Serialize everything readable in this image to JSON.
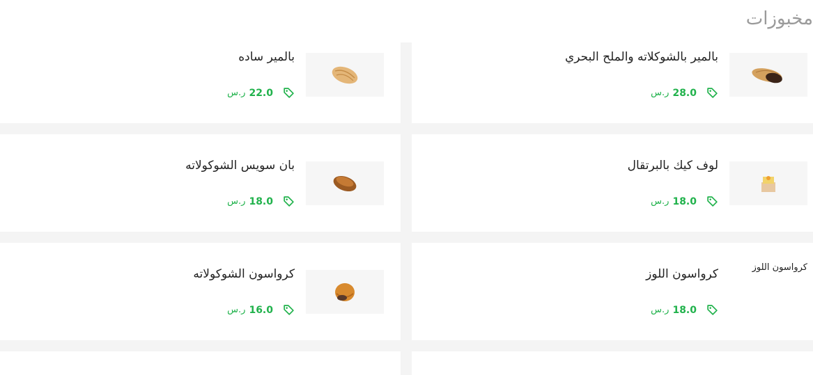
{
  "section": {
    "title": "مخبوزات"
  },
  "colors": {
    "price_green": "#21b24c",
    "title_gray": "#9a9a9a",
    "text_dark": "#222222"
  },
  "currency": "ر.س",
  "products": [
    {
      "name": "بالمير بالشوكلاته والملح البحري",
      "price": "28.0",
      "image": "palmier-chocolate-image",
      "image_alt": ""
    },
    {
      "name": "بالمير ساده",
      "price": "22.0",
      "image": "palmier-plain-image",
      "image_alt": ""
    },
    {
      "name": "لوف كيك بالبرتقال",
      "price": "18.0",
      "image": "orange-loaf-cake-image",
      "image_alt": ""
    },
    {
      "name": "بان سويس الشوكولاته",
      "price": "18.0",
      "image": "pain-suisse-chocolate-image",
      "image_alt": ""
    },
    {
      "name": "كرواسون اللوز",
      "price": "18.0",
      "image": "",
      "image_alt": "كرواسون اللوز"
    },
    {
      "name": "كرواسون الشوكولاته",
      "price": "16.0",
      "image": "chocolate-croissant-image",
      "image_alt": ""
    }
  ]
}
